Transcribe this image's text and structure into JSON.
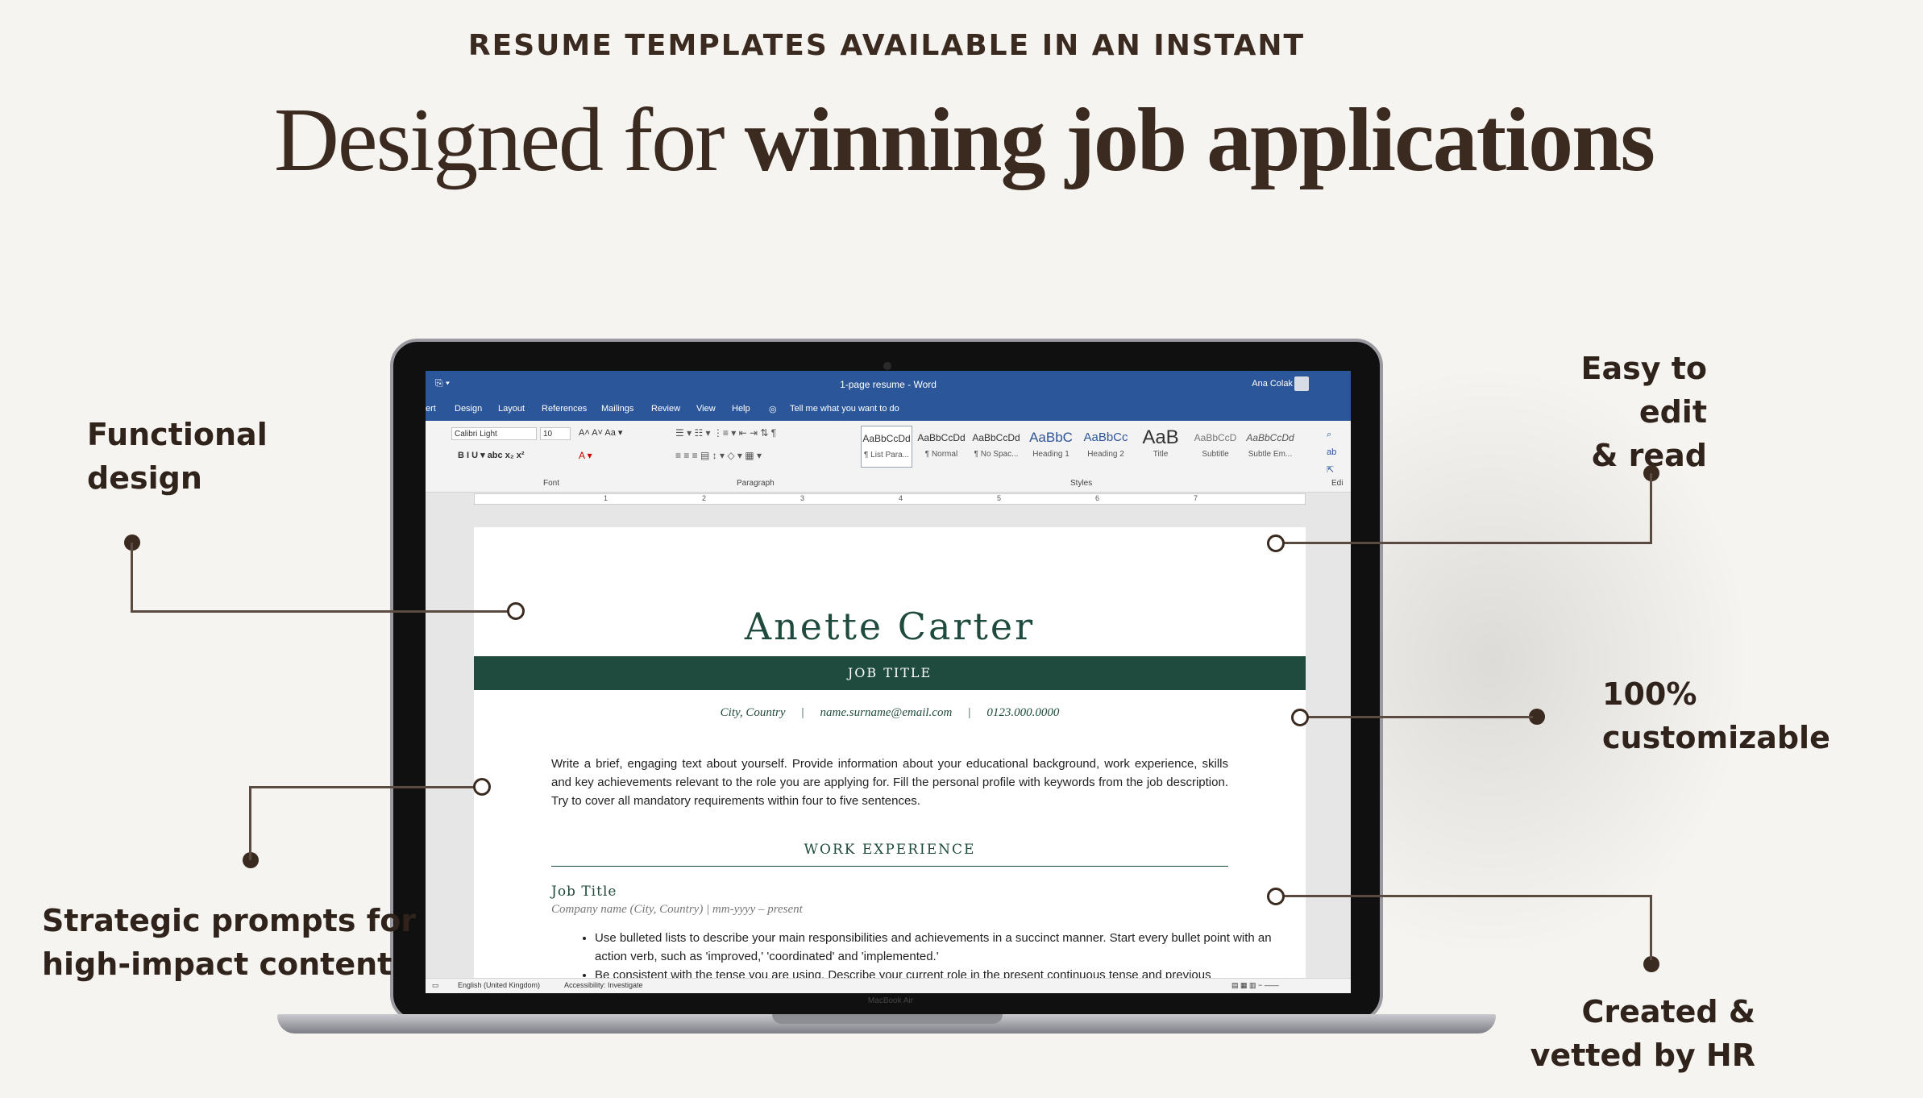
{
  "kicker": "RESUME TEMPLATES AVAILABLE IN AN INSTANT",
  "headline": {
    "regular": "Designed for ",
    "bold": "winning job applications"
  },
  "callouts": {
    "functional": [
      "Functional",
      "design"
    ],
    "strategic": [
      "Strategic prompts for",
      "high-impact content"
    ],
    "easy": [
      "Easy to edit",
      "& read"
    ],
    "customizable": [
      "100%",
      "customizable"
    ],
    "vetted": [
      "Created &",
      "vetted by HR"
    ]
  },
  "word": {
    "title": "1-page resume  -  Word",
    "user": "Ana Colak",
    "menu": [
      "ert",
      "Design",
      "Layout",
      "References",
      "Mailings",
      "Review",
      "View",
      "Help",
      "Tell me what you want to do"
    ],
    "font_name": "Calibri Light",
    "font_size": "10",
    "group_font": "Font",
    "group_paragraph": "Paragraph",
    "group_styles": "Styles",
    "group_edit": "Edi",
    "styles": [
      {
        "sample": "AaBbCcDd",
        "name": "¶ List Para..."
      },
      {
        "sample": "AaBbCcDd",
        "name": "¶ Normal"
      },
      {
        "sample": "AaBbCcDd",
        "name": "¶ No Spac..."
      },
      {
        "sample": "AaBbC",
        "name": "Heading 1"
      },
      {
        "sample": "AaBbCc",
        "name": "Heading 2"
      },
      {
        "sample": "AaB",
        "name": "Title"
      },
      {
        "sample": "AaBbCcD",
        "name": "Subtitle"
      },
      {
        "sample": "AaBbCcDd",
        "name": "Subtle Em..."
      }
    ],
    "status_language": "English (United Kingdom)",
    "status_accessibility": "Accessibility: Investigate",
    "laptop_label": "MacBook Air"
  },
  "resume": {
    "name": "Anette Carter",
    "job_title": "JOB TITLE",
    "city": "City, Country",
    "email": "name.surname@email.com",
    "phone": "0123.000.0000",
    "summary": "Write a brief, engaging text about yourself. Provide information about your educational background, work experience, skills and key achievements relevant to the role you are applying for. Fill the personal profile with keywords from the job description. Try to cover all mandatory requirements within four to five sentences.",
    "section": "WORK EXPERIENCE",
    "entry_title": "Job Title",
    "entry_company": "Company name (City, Country) | mm-yyyy – present",
    "bullets": [
      "Use bulleted lists to describe your main responsibilities and achievements in a succinct manner. Start every bullet point with an action verb, such as 'improved,' 'coordinated' and 'implemented.'",
      "Be consistent with the tense you are using. Describe your current role in the present continuous tense and previous"
    ]
  },
  "colors": {
    "accent_green": "#1f4a3e",
    "word_blue": "#2b579a",
    "text_brown": "#3a2a1f"
  }
}
